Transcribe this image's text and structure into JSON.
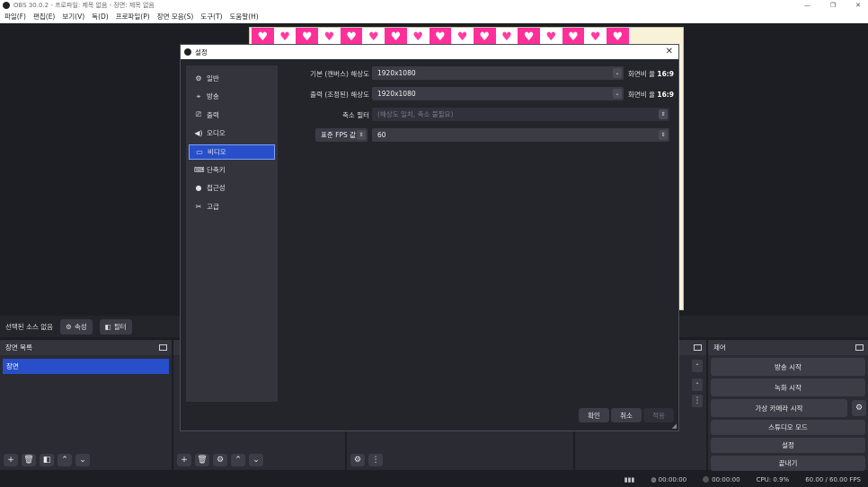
{
  "window": {
    "title": "OBS 30.0.2 - 프로파일: 제목 없음 - 장면: 제목 없음",
    "controls": [
      "—",
      "❐",
      "✕"
    ]
  },
  "menu": [
    "파일(F)",
    "편집(E)",
    "보기(V)",
    "독(D)",
    "프로파일(P)",
    "장면 모음(S)",
    "도구(T)",
    "도움말(H)"
  ],
  "sources_bar": {
    "no_source": "선택된 소스 없음",
    "properties": "속성",
    "filters": "필터"
  },
  "scenes": {
    "title": "장면 목록",
    "items": [
      "장면"
    ]
  },
  "controls": {
    "title": "제어",
    "buttons": [
      "방송 시작",
      "녹화 시작",
      "가상 카메라 시작",
      "스튜디오 모드",
      "설정",
      "끝내기"
    ]
  },
  "status": {
    "rec_time": "00:00:00",
    "stream_time": "00:00:00",
    "cpu": "CPU: 0.9%",
    "fps": "60.00 / 60.00 FPS"
  },
  "dialog": {
    "title": "설정",
    "nav": [
      {
        "label": "일반",
        "icon": "gear-icon",
        "glyph": "⚙"
      },
      {
        "label": "방송",
        "icon": "antenna-icon",
        "glyph": "📡"
      },
      {
        "label": "출력",
        "icon": "output-icon",
        "glyph": "⎚"
      },
      {
        "label": "오디오",
        "icon": "speaker-icon",
        "glyph": "🔊"
      },
      {
        "label": "비디오",
        "icon": "monitor-icon",
        "glyph": "▭"
      },
      {
        "label": "단축키",
        "icon": "keyboard-icon",
        "glyph": "⌨"
      },
      {
        "label": "접근성",
        "icon": "accessibility-icon",
        "glyph": "♿"
      },
      {
        "label": "고급",
        "icon": "tools-icon",
        "glyph": "✂"
      }
    ],
    "active_nav": "비디오",
    "base_res_label": "기본 (캔버스) 해상도",
    "base_res_value": "1920x1080",
    "base_ratio_label": "화면비 율",
    "base_ratio_value": "16:9",
    "out_res_label": "출력 (조정된) 해상도",
    "out_res_value": "1920x1080",
    "out_ratio_label": "화면비 율",
    "out_ratio_value": "16:9",
    "filter_label": "축소 필터",
    "filter_value": "(해상도 일치, 축소 불필요)",
    "fps_type": "표준 FPS 값",
    "fps_value": "60",
    "ok": "확인",
    "cancel": "취소",
    "apply": "적용"
  }
}
